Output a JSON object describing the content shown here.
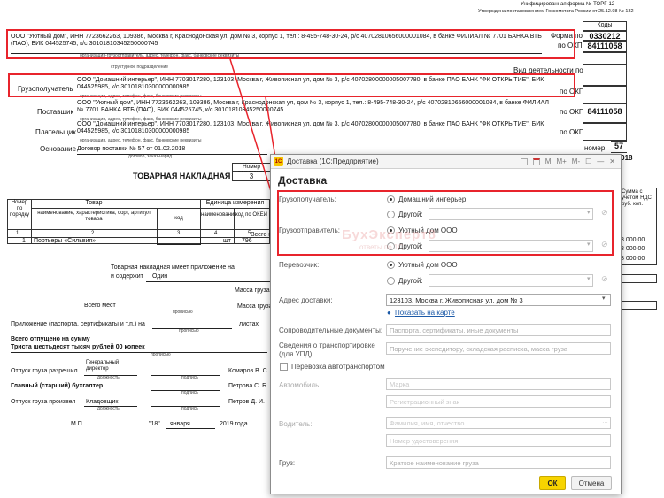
{
  "header_right": {
    "form_note": "Унифицированная форма № ТОРГ-12",
    "approved_note": "Утверждена постановлением Госкомстата России от 25.12.98 № 132",
    "codes_label": "Коды",
    "okud_label": "Форма по ОКУД",
    "okud_value": "0330212",
    "okpo_label": "по ОКПО",
    "okpo_value": "84111058",
    "activity_label": "Вид деятельности по ОКДП",
    "okpo2_label": "по ОКПО",
    "okpo3_label": "по ОКПО",
    "okpo3_value": "84111058",
    "okpo4_label": "по ОКПО",
    "number_label": "номер",
    "number_value": "57",
    "date_value": "2.2018"
  },
  "doc": {
    "shipper_text": "ООО \"Уютный дом\", ИНН 7723662263, 109386, Москва г, Краснодонская ул, дом № 3, корпус 1, тел.: 8-495-748-30-24, р/с 40702810656000001084, в банке ФИЛИАЛ № 7701 БАНКА ВТБ (ПАО), БИК 044525745, к/с 30101810345250000745",
    "shipper_caption": "организация-грузоотправитель, адрес, телефон, факс, банковские реквизиты",
    "division_caption": "структурное подразделение",
    "consignee_label": "Грузополучатель",
    "consignee_text": "ООО \"Домашний интерьер\", ИНН 7703017280, 123103, Москва г, Живописная ул, дом № 3, р/с 40702800000005007780, в банке ПАО БАНК \"ФК ОТКРЫТИЕ\", БИК 044525985, к/с 30101810300000000985",
    "org_caption": "организация, адрес, телефон, факс, банковские реквизиты",
    "supplier_label": "Поставщик",
    "supplier_text": "ООО \"Уютный дом\", ИНН 7723662263, 109386, Москва г, Краснодонская ул, дом № 3, корпус 1, тел.: 8-495-748-30-24, р/с 40702810656000001084, в банке ФИЛИАЛ № 7701 БАНКА ВТБ (ПАО), БИК 044525745, к/с 30101810345250000745",
    "payer_label": "Плательщик",
    "payer_text": "ООО \"Домашний интерьер\", ИНН 7703017280, 123103, Москва г, Живописная ул, дом № 3, р/с 40702800000005007780, в банке ПАО БАНК \"ФК ОТКРЫТИЕ\", БИК 044525985, к/с 30101810300000000985",
    "basis_label": "Основание",
    "basis_text": "Договор поставки № 57 от 01.02.2018",
    "basis_caption": "договор, заказ-наряд",
    "doc_number_label": "Номер документа",
    "doc_number_value": "3",
    "title": "ТОВАРНАЯ НАКЛАДНАЯ",
    "col_num": "Номер по порядку",
    "col_goods": "Товар",
    "col_goods_name": "наименование, характеристика, сорт, артикул товара",
    "col_code": "код",
    "col_unit": "Единица измерения",
    "col_unit_name": "наименование",
    "col_okei": "код по ОКЕИ",
    "idx_1": "1",
    "idx_2": "2",
    "idx_3": "3",
    "idx_4": "4",
    "idx_5": "5",
    "row_num": "1",
    "row_name": "Портьеры «Сильвия»",
    "row_unit": "шт",
    "row_okei": "796",
    "right_col_head": "Сумма с учетом НДС, руб. коп.",
    "right_val_1": "8 000,00",
    "right_val_2": "8 000,00",
    "right_val_3": "8 000,00",
    "total_label": "Всего п",
    "attach_line1": "Товарная накладная имеет приложение на",
    "attach_line2": "и содержит",
    "attach_value": "Один",
    "gross_label": "Масса груза",
    "places_label": "Всего мест",
    "gross2_label": "Масса груза",
    "propis": "прописью",
    "appendix_label": "Приложение (паспорта, сертификаты и т.п.) на",
    "sheets_label": "листах",
    "released_label": "Всего отпущено  на сумму",
    "released_text": "Триста шестьдесят тысяч рублей 00 копеек",
    "allowed_label": "Отпуск груза разрешил",
    "allowed_pos": "Генеральный директор",
    "allowed_name": "Комаров В. С.",
    "chief_label": "Главный (старший) бухгалтер",
    "chief_name": "Петрова С. Б.",
    "made_label": "Отпуск груза произвел",
    "made_pos": "Кладовщик",
    "made_name": "Петров Д. И.",
    "pos_caption": "должность",
    "sign_caption": "подпись",
    "name_caption": "расшифровка подписи",
    "mp": "М.П.",
    "date_day": "\"18\"",
    "date_month": "января",
    "date_year": "2019 года"
  },
  "dialog": {
    "window_title": "Доставка  (1С:Предприятие)",
    "app_icon": "1С",
    "heading": "Доставка",
    "consignee_label": "Грузополучатель:",
    "consignee_opt1": "Домашний интерьер",
    "consignee_opt2": "Другой:",
    "shipper_label": "Грузоотправитель:",
    "shipper_opt1": "Уютный дом ООО",
    "shipper_opt2": "Другой:",
    "carrier_label": "Перевозчик:",
    "carrier_opt1": "Уютный дом ООО",
    "carrier_opt2": "Другой:",
    "address_label": "Адрес доставки:",
    "address_value": "123103, Москва г, Живописная ул, дом № 3",
    "map_link": "Показать на карте",
    "docs_label": "Сопроводительные документы:",
    "docs_placeholder": "Паспорта, сертификаты, иные документы",
    "transport_label": "Сведения о транспортировке (для УПД):",
    "transport_placeholder": "Поручение экспедитору, складская расписка, масса груза",
    "auto_label": "Перевозка автотранспортом",
    "car_label": "Автомобиль:",
    "car_ph1": "Марка",
    "car_ph2": "Регистрационный знак",
    "driver_label": "Водитель:",
    "driver_ph1": "Фамилия, имя, отчество",
    "driver_ph2": "Номер удостоверения",
    "cargo_label": "Груз:",
    "cargo_placeholder": "Краткое наименование груза",
    "ok": "ОК",
    "cancel": "Отмена",
    "watermark": "БухЭксперт8",
    "watermark_sub": "ответы по 1С",
    "tools": [
      "M",
      "M+",
      "M-",
      "☐",
      "—",
      "✕"
    ]
  },
  "colors": {
    "highlight": "#e8242c",
    "ok_button": "#f7d400",
    "link": "#1c5aa8"
  }
}
